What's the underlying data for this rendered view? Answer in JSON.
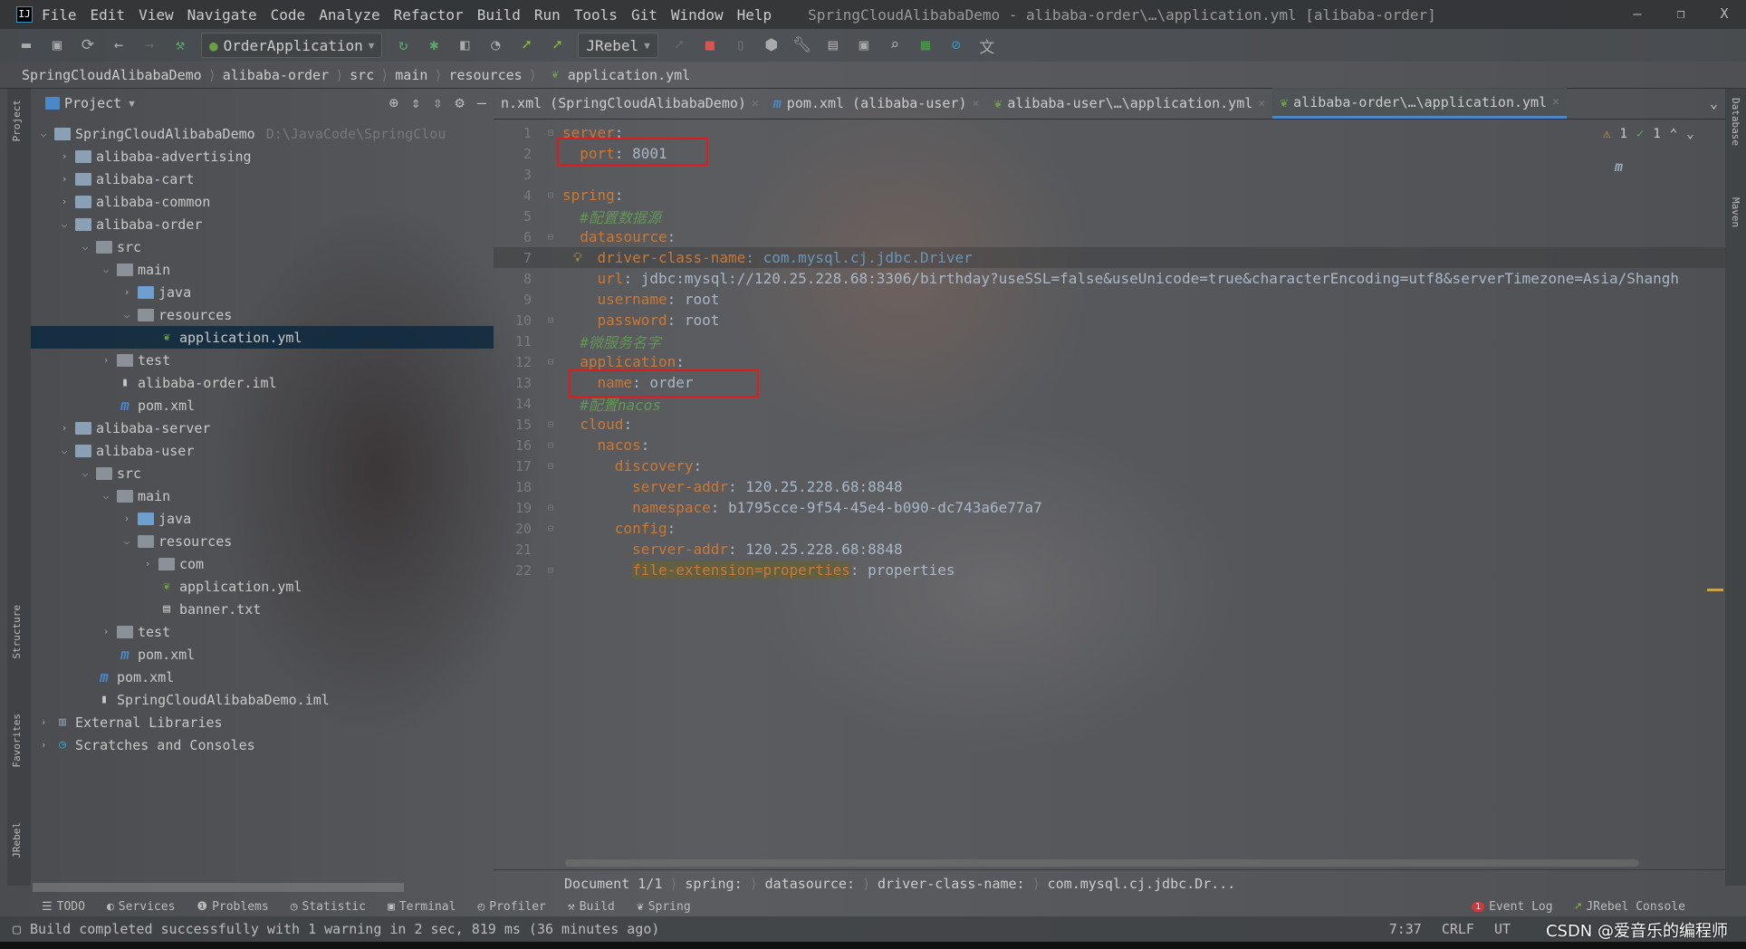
{
  "window": {
    "title": "SpringCloudAlibabaDemo - alibaba-order\\…\\application.yml [alibaba-order]",
    "minimize": "–",
    "restore": "❐",
    "close": "X"
  },
  "menu": [
    "File",
    "Edit",
    "View",
    "Navigate",
    "Code",
    "Analyze",
    "Refactor",
    "Build",
    "Run",
    "Tools",
    "Git",
    "Window",
    "Help"
  ],
  "toolbar": {
    "run_config": "OrderApplication",
    "jrebel": "JRebel"
  },
  "breadcrumb": [
    "SpringCloudAlibabaDemo",
    "alibaba-order",
    "src",
    "main",
    "resources",
    "application.yml"
  ],
  "project_panel": {
    "title": "Project"
  },
  "tree": [
    {
      "label": "SpringCloudAlibabaDemo",
      "hint": "D:\\JavaCode\\SpringClou",
      "depth": 0,
      "arrow": "down",
      "icon": "module"
    },
    {
      "label": "alibaba-advertising",
      "depth": 1,
      "arrow": "right",
      "icon": "module"
    },
    {
      "label": "alibaba-cart",
      "depth": 1,
      "arrow": "right",
      "icon": "module"
    },
    {
      "label": "alibaba-common",
      "depth": 1,
      "arrow": "right",
      "icon": "module"
    },
    {
      "label": "alibaba-order",
      "depth": 1,
      "arrow": "down",
      "icon": "module"
    },
    {
      "label": "src",
      "depth": 2,
      "arrow": "down",
      "icon": "folder"
    },
    {
      "label": "main",
      "depth": 3,
      "arrow": "down",
      "icon": "folder"
    },
    {
      "label": "java",
      "depth": 4,
      "arrow": "right",
      "icon": "folder-blue"
    },
    {
      "label": "resources",
      "depth": 4,
      "arrow": "down",
      "icon": "folder"
    },
    {
      "label": "application.yml",
      "depth": 5,
      "arrow": "",
      "icon": "spring-yml",
      "selected": true
    },
    {
      "label": "test",
      "depth": 3,
      "arrow": "right",
      "icon": "folder"
    },
    {
      "label": "alibaba-order.iml",
      "depth": 3,
      "arrow": "",
      "icon": "iml"
    },
    {
      "label": "pom.xml",
      "depth": 3,
      "arrow": "",
      "icon": "maven"
    },
    {
      "label": "alibaba-server",
      "depth": 1,
      "arrow": "right",
      "icon": "module"
    },
    {
      "label": "alibaba-user",
      "depth": 1,
      "arrow": "down",
      "icon": "module"
    },
    {
      "label": "src",
      "depth": 2,
      "arrow": "down",
      "icon": "folder"
    },
    {
      "label": "main",
      "depth": 3,
      "arrow": "down",
      "icon": "folder"
    },
    {
      "label": "java",
      "depth": 4,
      "arrow": "right",
      "icon": "folder-blue"
    },
    {
      "label": "resources",
      "depth": 4,
      "arrow": "down",
      "icon": "folder"
    },
    {
      "label": "com",
      "depth": 5,
      "arrow": "right",
      "icon": "folder"
    },
    {
      "label": "application.yml",
      "depth": 5,
      "arrow": "",
      "icon": "spring-yml"
    },
    {
      "label": "banner.txt",
      "depth": 5,
      "arrow": "",
      "icon": "text"
    },
    {
      "label": "test",
      "depth": 3,
      "arrow": "right",
      "icon": "folder"
    },
    {
      "label": "pom.xml",
      "depth": 3,
      "arrow": "",
      "icon": "maven"
    },
    {
      "label": "pom.xml",
      "depth": 2,
      "arrow": "",
      "icon": "maven"
    },
    {
      "label": "SpringCloudAlibabaDemo.iml",
      "depth": 2,
      "arrow": "",
      "icon": "iml"
    },
    {
      "label": "External Libraries",
      "depth": 0,
      "arrow": "right",
      "icon": "libraries"
    },
    {
      "label": "Scratches and Consoles",
      "depth": 0,
      "arrow": "right",
      "icon": "scratches"
    }
  ],
  "tabs": [
    {
      "label": "n.xml (SpringCloudAlibabaDemo)",
      "icon": "none"
    },
    {
      "label": "pom.xml (alibaba-user)",
      "icon": "maven"
    },
    {
      "label": "alibaba-user\\…\\application.yml",
      "icon": "spring-yml"
    },
    {
      "label": "alibaba-order\\…\\application.yml",
      "icon": "spring-yml",
      "active": true
    }
  ],
  "inspections": {
    "warnings": "1",
    "ok": "1"
  },
  "code": [
    [
      {
        "t": "server",
        "c": "k"
      },
      {
        "t": ":",
        "c": "v"
      }
    ],
    [
      {
        "t": "  port",
        "c": "k"
      },
      {
        "t": ": 8001",
        "c": "v"
      }
    ],
    [],
    [
      {
        "t": "spring",
        "c": "k"
      },
      {
        "t": ":",
        "c": "v"
      }
    ],
    [
      {
        "t": "  #配置数据源",
        "c": "c"
      }
    ],
    [
      {
        "t": "  datasource",
        "c": "k"
      },
      {
        "t": ":",
        "c": "v"
      }
    ],
    [
      {
        "t": "    driver-class-name",
        "c": "k"
      },
      {
        "t": ": com.mysql.cj.jdbc.Driver",
        "c": "cl"
      }
    ],
    [
      {
        "t": "    url",
        "c": "k"
      },
      {
        "t": ": jdbc:mysql://120.25.228.68:3306/birthday?useSSL=false&useUnicode=true&characterEncoding=utf8&serverTimezone=Asia/Shangh",
        "c": "v"
      }
    ],
    [
      {
        "t": "    username",
        "c": "k"
      },
      {
        "t": ": root",
        "c": "v"
      }
    ],
    [
      {
        "t": "    password",
        "c": "k"
      },
      {
        "t": ": root",
        "c": "v"
      }
    ],
    [
      {
        "t": "  #微服务名字",
        "c": "c"
      }
    ],
    [
      {
        "t": "  application",
        "c": "k"
      },
      {
        "t": ":",
        "c": "v"
      }
    ],
    [
      {
        "t": "    name",
        "c": "k"
      },
      {
        "t": ": order",
        "c": "v"
      }
    ],
    [
      {
        "t": "  #配置nacos",
        "c": "c"
      }
    ],
    [
      {
        "t": "  cloud",
        "c": "k"
      },
      {
        "t": ":",
        "c": "v"
      }
    ],
    [
      {
        "t": "    nacos",
        "c": "k"
      },
      {
        "t": ":",
        "c": "v"
      }
    ],
    [
      {
        "t": "      discovery",
        "c": "k"
      },
      {
        "t": ":",
        "c": "v"
      }
    ],
    [
      {
        "t": "        server-addr",
        "c": "k"
      },
      {
        "t": ": 120.25.228.68:8848",
        "c": "v"
      }
    ],
    [
      {
        "t": "        namespace",
        "c": "k"
      },
      {
        "t": ": b1795cce-9f54-45e4-b090-dc743a6e77a7",
        "c": "v"
      }
    ],
    [
      {
        "t": "      config",
        "c": "k"
      },
      {
        "t": ":",
        "c": "v"
      }
    ],
    [
      {
        "t": "        server-addr",
        "c": "k"
      },
      {
        "t": ": 120.25.228.68:8848",
        "c": "v"
      }
    ],
    [
      {
        "t": "        ",
        "c": "v"
      },
      {
        "t": "file-extension=properties",
        "c": "k hl"
      },
      {
        "t": ": properties",
        "c": "v"
      }
    ]
  ],
  "editor_breadcrumb": [
    "Document 1/1",
    "spring:",
    "datasource:",
    "driver-class-name:",
    "com.mysql.cj.jdbc.Dr..."
  ],
  "tool_windows_left": [
    "TODO",
    "Services",
    "Problems",
    "Statistic",
    "Terminal",
    "Profiler",
    "Build",
    "Spring"
  ],
  "tool_windows_right": [
    "Event Log",
    "JRebel Console"
  ],
  "event_log_count": "1",
  "left_strip": [
    "Project",
    "Structure",
    "Favorites",
    "JRebel"
  ],
  "right_strip": [
    "Database",
    "Maven"
  ],
  "status": {
    "message": "Build completed successfully with 1 warning in 2 sec, 819 ms (36 minutes ago)",
    "position": "7:37",
    "line_sep": "CRLF",
    "encoding": "UT"
  },
  "watermark": "CSDN @爱音乐的编程师"
}
